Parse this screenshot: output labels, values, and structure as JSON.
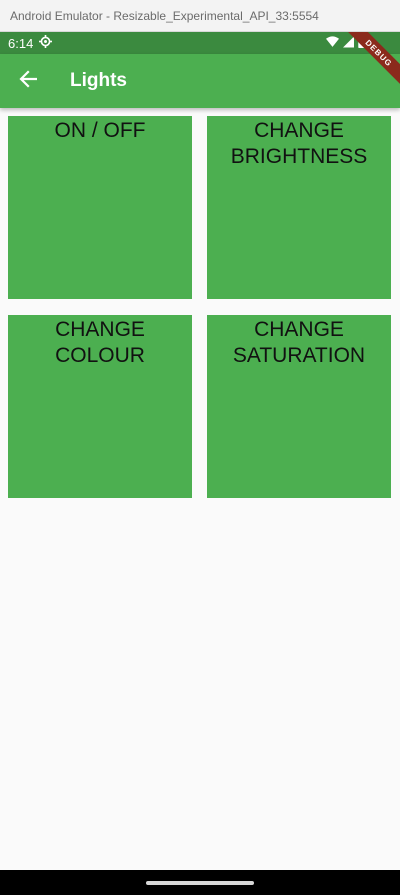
{
  "window": {
    "title": "Android Emulator - Resizable_Experimental_API_33:5554"
  },
  "status_bar": {
    "time": "6:14",
    "icons": [
      "settings-gear-icon",
      "wifi-icon",
      "signal-icon",
      "battery-icon"
    ]
  },
  "app_bar": {
    "title": "Lights",
    "back_icon": "arrow-left-icon",
    "color": "#4caf50"
  },
  "debug_banner": {
    "label": "DEBUG"
  },
  "tiles": [
    {
      "lines": [
        "ON / OFF"
      ]
    },
    {
      "lines": [
        "CHANGE",
        "BRIGHTNESS"
      ]
    },
    {
      "lines": [
        "CHANGE",
        "COLOUR"
      ]
    },
    {
      "lines": [
        "CHANGE",
        "SATURATION"
      ]
    }
  ],
  "colors": {
    "status_bar": "#3b8a3f",
    "tile": "#4caf50",
    "background": "#fafafa"
  }
}
